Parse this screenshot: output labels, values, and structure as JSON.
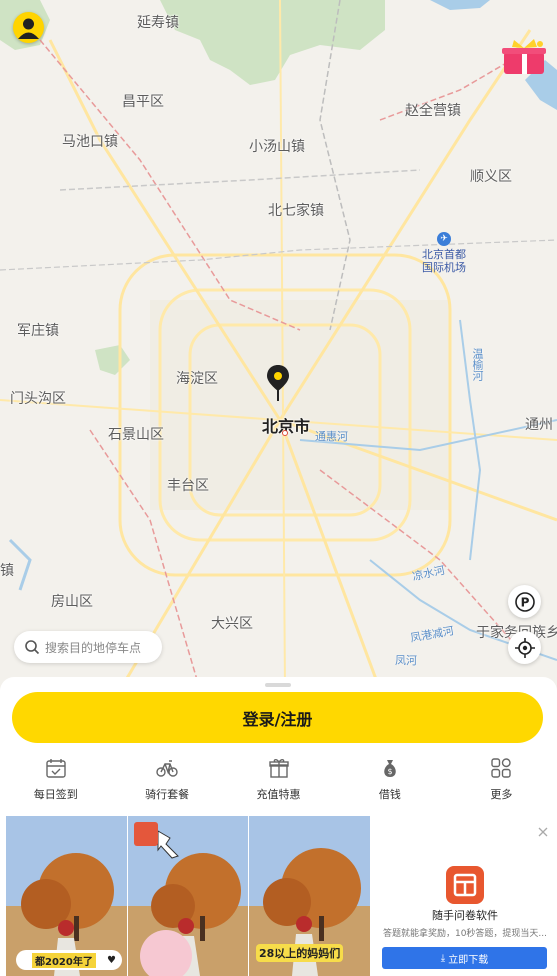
{
  "map": {
    "places": {
      "yanshou": "延寿镇",
      "changping": "昌平区",
      "zhaoquanying": "赵全营镇",
      "machikou": "马池口镇",
      "xiaotangshan": "小汤山镇",
      "shunyi": "顺义区",
      "beiqijia": "北七家镇",
      "airport": "北京首都\n国际机场",
      "junzhuang": "军庄镇",
      "mentougou": "门头沟区",
      "haidian": "海淀区",
      "beijing": "北京市",
      "shijingshan": "石景山区",
      "tongzhou": "通州",
      "fengtai": "丰台区",
      "zhen_left": "镇",
      "fangshan": "房山区",
      "daxing": "大兴区",
      "yujiawu": "于家务回族乡"
    },
    "water": {
      "tonghui": "通惠河",
      "wenyu": "温榆河",
      "liangshui": "凉水河",
      "fenggang": "凤港减河",
      "feng": "凤河"
    },
    "search_placeholder": "搜索目的地停车点",
    "parking_label": "P"
  },
  "sheet": {
    "login_label": "登录/注册",
    "quick": [
      {
        "label": "每日签到",
        "icon": "calendar-check-icon"
      },
      {
        "label": "骑行套餐",
        "icon": "bicycle-icon"
      },
      {
        "label": "充值特惠",
        "icon": "gift-box-icon"
      },
      {
        "label": "借钱",
        "icon": "money-bag-icon"
      },
      {
        "label": "更多",
        "icon": "grid-more-icon"
      }
    ]
  },
  "ad": {
    "caption1": "都2020年了",
    "caption3": "28以上的妈妈们",
    "app_name": "随手问卷软件",
    "app_desc": "答题就能拿奖励，10秒答题，提现当天...",
    "download_label": "立即下载"
  },
  "colors": {
    "accent": "#ffd800",
    "download": "#2f74e8"
  }
}
